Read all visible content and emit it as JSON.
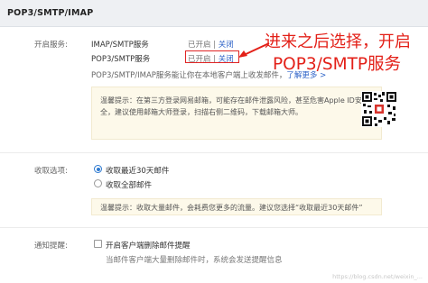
{
  "section": {
    "title": "POP3/SMTP/IMAP"
  },
  "service": {
    "label": "开启服务:",
    "rows": [
      {
        "name": "IMAP/SMTP服务",
        "status": "已开启",
        "sep": " | ",
        "action": "关闭"
      },
      {
        "name": "POP3/SMTP服务",
        "status": "已开启",
        "sep": " | ",
        "action": "关闭"
      }
    ],
    "note": "POP3/SMTP/IMAP服务能让你在本地客户端上收发邮件，",
    "note_link": "了解更多 >"
  },
  "annotation": {
    "line1": "进来之后选择，开启",
    "line2": "POP3/SMTP服务",
    "color": "#e32018"
  },
  "tip1": {
    "line1": "温馨提示：在第三方登录网易邮箱，可能存在邮件泄露风险，甚至危害Apple ID安",
    "line2": "全，建议使用邮箱大师登录，扫描右侧二维码，下载邮箱大师。"
  },
  "receive": {
    "label": "收取选项:",
    "options": [
      {
        "label": "收取最近30天邮件",
        "checked": true
      },
      {
        "label": "收取全部邮件",
        "checked": false
      }
    ]
  },
  "tip2": {
    "text": "温馨提示：收取大量邮件，会耗费您更多的流量。建议您选择“收取最近30天邮件”"
  },
  "sync": {
    "label": "通知提醒:",
    "option": "开启客户端删除邮件提醒",
    "note": "当邮件客户端大量删除邮件时，系统会发送提醒信息"
  },
  "watermark": "https://blog.csdn.net/weixin_..."
}
